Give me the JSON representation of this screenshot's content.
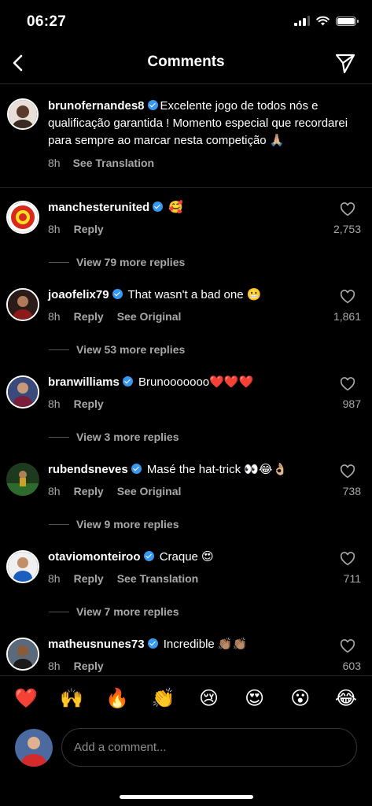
{
  "status": {
    "time": "06:27"
  },
  "header": {
    "title": "Comments"
  },
  "caption": {
    "username": "brunofernandes8",
    "text": "Excelente jogo de todos nós e qualificação garantida ! Momento especial que recordarei para sempre ao marcar nesta competição 🙏🏼",
    "time": "8h",
    "action": "See Translation"
  },
  "comments": [
    {
      "username": "manchesterunited",
      "text": "🥰",
      "time": "8h",
      "reply": "Reply",
      "extra": "",
      "likes": "2,753",
      "replies": "View 79 more replies"
    },
    {
      "username": "joaofelix79",
      "text": "That wasn't a bad one 😬",
      "time": "8h",
      "reply": "Reply",
      "extra": "See Original",
      "likes": "1,861",
      "replies": "View 53 more replies"
    },
    {
      "username": "branwilliams",
      "text": "Brunooooooo❤️❤️❤️",
      "time": "8h",
      "reply": "Reply",
      "extra": "",
      "likes": "987",
      "replies": "View 3 more replies"
    },
    {
      "username": "rubendsneves",
      "text": "Masé the hat-trick 👀😂👌🏼",
      "time": "8h",
      "reply": "Reply",
      "extra": "See Original",
      "likes": "738",
      "replies": "View 9 more replies"
    },
    {
      "username": "otaviomonteiroo",
      "text": "Craque 😍",
      "time": "8h",
      "reply": "Reply",
      "extra": "See Translation",
      "likes": "711",
      "replies": "View 7 more replies"
    },
    {
      "username": "matheusnunes73",
      "text": "Incredible 👏🏽👏🏽",
      "time": "8h",
      "reply": "Reply",
      "extra": "",
      "likes": "603",
      "replies": ""
    }
  ],
  "emoji_bar": [
    "❤️",
    "🙌",
    "🔥",
    "👏",
    "😢",
    "😍",
    "😮",
    "😂"
  ],
  "composer": {
    "placeholder": "Add a comment..."
  },
  "icons": {
    "back": "chevron-left-icon",
    "share": "paper-plane-icon",
    "like": "heart-outline-icon",
    "verified": "verified-badge-icon"
  },
  "colors": {
    "verified": "#3897f0",
    "background": "#000000",
    "secondary_text": "#a8a8a8"
  }
}
